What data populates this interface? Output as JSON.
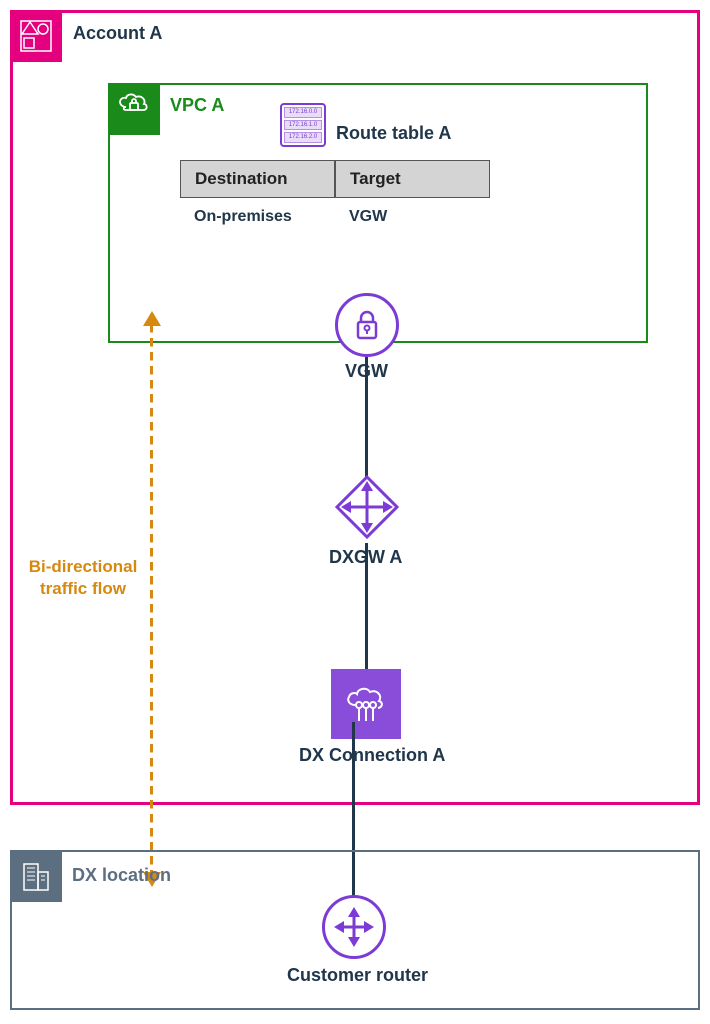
{
  "account": {
    "label": "Account A"
  },
  "vpc": {
    "label": "VPC A"
  },
  "route_table": {
    "title": "Route table A",
    "headers": {
      "dest": "Destination",
      "target": "Target"
    },
    "row": {
      "dest": "On-premises",
      "target": "VGW"
    }
  },
  "vgw": {
    "label": "VGW"
  },
  "dxgw": {
    "label": "DXGW A"
  },
  "dxconn": {
    "label": "DX Connection A"
  },
  "flow": {
    "label": "Bi-directional traffic flow"
  },
  "dxloc": {
    "label": "DX location"
  },
  "router": {
    "label": "Customer router"
  }
}
